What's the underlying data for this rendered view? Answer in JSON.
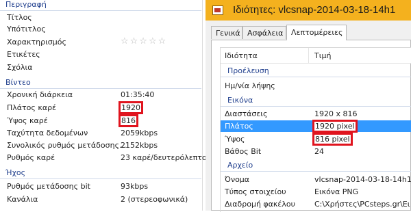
{
  "left": {
    "description": {
      "header": "Περιγραφή",
      "rows": [
        {
          "label": "Τίτλος",
          "value": ""
        },
        {
          "label": "Υπότιτλος",
          "value": ""
        },
        {
          "label": "Χαρακτηρισμός",
          "value": ""
        },
        {
          "label": "Ετικέτες",
          "value": ""
        },
        {
          "label": "Σχόλια",
          "value": ""
        }
      ],
      "rating_stars": "☆☆☆☆☆"
    },
    "video": {
      "header": "Βίντεο",
      "rows": [
        {
          "label": "Χρονική διάρκεια",
          "value": "01:35:40"
        },
        {
          "label": "Πλάτος καρέ",
          "value": "1920"
        },
        {
          "label": "Ύψος καρέ",
          "value": "816"
        },
        {
          "label": "Ταχύτητα δεδομένων",
          "value": "2059kbps"
        },
        {
          "label": "Συνολικός ρυθμός μετάδοσης...",
          "value": "2152kbps"
        },
        {
          "label": "Ρυθμός καρέ",
          "value": "23 καρέ/δευτερόλεπτο"
        }
      ]
    },
    "audio": {
      "header": "Ήχος",
      "rows": [
        {
          "label": "Ρυθμός μετάδοσης bit",
          "value": "93kbps"
        },
        {
          "label": "Κανάλια",
          "value": "2 (στερεοφωνικά)"
        }
      ]
    }
  },
  "dialog": {
    "title": "Ιδιότητες: vlcsnap-2014-03-18-14h1",
    "tabs": [
      "Γενικά",
      "Ασφάλεια",
      "Λεπτομέρειες"
    ],
    "active_tab": 2,
    "columns": {
      "property": "Ιδιότητα",
      "value": "Τιμή"
    },
    "sections": {
      "origin": {
        "header": "Προέλευση",
        "rows": [
          {
            "label": "Ημ/νία λήψης",
            "value": ""
          }
        ]
      },
      "image": {
        "header": "Εικόνα",
        "rows": [
          {
            "label": "Διαστάσεις",
            "value": "1920 x 816"
          },
          {
            "label": "Πλάτος",
            "value": "1920 pixel"
          },
          {
            "label": "Ύψος",
            "value": "816 pixel"
          },
          {
            "label": "Βάθος Bit",
            "value": "24"
          }
        ]
      },
      "file": {
        "header": "Αρχείο",
        "rows": [
          {
            "label": "Όνομα",
            "value": "vlcsnap-2014-03-18-14h1"
          },
          {
            "label": "Τύπος στοιχείου",
            "value": "Εικόνα PNG"
          },
          {
            "label": "Διαδρομή φακέλου",
            "value": "C:\\Χρήστες\\PCsteps.gr\\Ει"
          }
        ]
      }
    }
  },
  "colors": {
    "section_header": "#1e3d8c",
    "highlight_box": "#e0141e",
    "title_bar": "#f4b11e",
    "selection": "#3399ff"
  }
}
